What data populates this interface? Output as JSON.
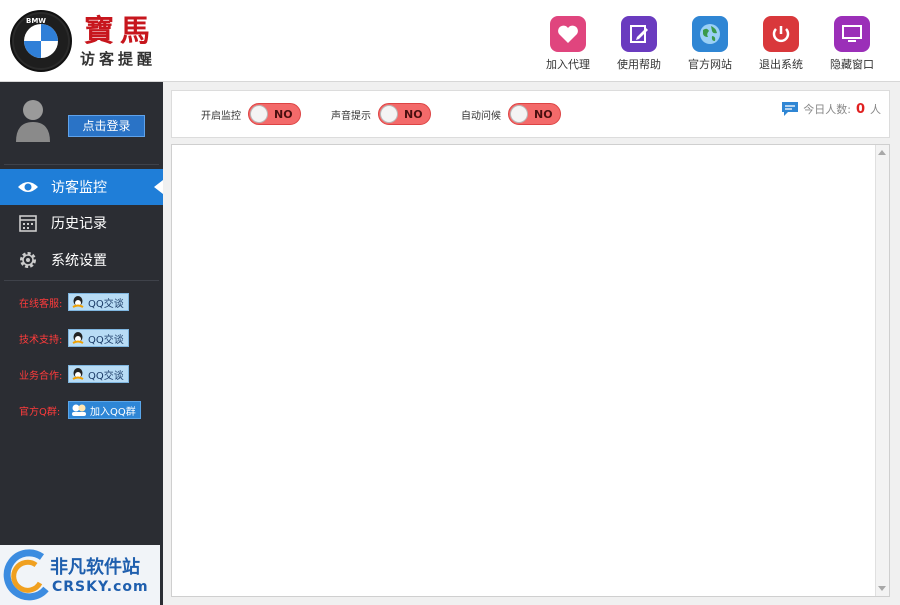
{
  "header": {
    "logo_text": "BMW",
    "brand_big": "寶馬",
    "brand_small": "访客提醒",
    "buttons": [
      {
        "id": "join-agent",
        "label": "加入代理",
        "color": "#e0457e",
        "icon": "heart-icon"
      },
      {
        "id": "help",
        "label": "使用帮助",
        "color": "#6a3bbf",
        "icon": "edit-icon"
      },
      {
        "id": "website",
        "label": "官方网站",
        "color": "#2f86d4",
        "icon": "globe-icon"
      },
      {
        "id": "exit",
        "label": "退出系统",
        "color": "#d9383b",
        "icon": "power-icon"
      },
      {
        "id": "hide",
        "label": "隐藏窗口",
        "color": "#9b2fb8",
        "icon": "monitor-icon"
      }
    ]
  },
  "sidebar": {
    "login_label": "点击登录",
    "nav": [
      {
        "label": "访客监控",
        "icon": "eye-icon",
        "active": true
      },
      {
        "label": "历史记录",
        "icon": "calendar-icon",
        "active": false
      },
      {
        "label": "系统设置",
        "icon": "gear-icon",
        "active": false
      }
    ],
    "support": [
      {
        "label": "在线客服:",
        "button": "QQ交谈",
        "icon": "qq-icon"
      },
      {
        "label": "技术支持:",
        "button": "QQ交谈",
        "icon": "qq-icon"
      },
      {
        "label": "业务合作:",
        "button": "QQ交谈",
        "icon": "qq-icon"
      },
      {
        "label": "官方Q群:",
        "button": "加入QQ群",
        "icon": "qq-group-icon"
      }
    ],
    "watermark": {
      "text": "非凡软件站",
      "sub": "CRSKY.com"
    }
  },
  "controls": {
    "toggles": [
      {
        "label": "开启监控",
        "state": "NO"
      },
      {
        "label": "声音提示",
        "state": "NO"
      },
      {
        "label": "自动问候",
        "state": "NO"
      }
    ],
    "today_label": "今日人数:",
    "today_count": "0",
    "today_unit": "人"
  }
}
